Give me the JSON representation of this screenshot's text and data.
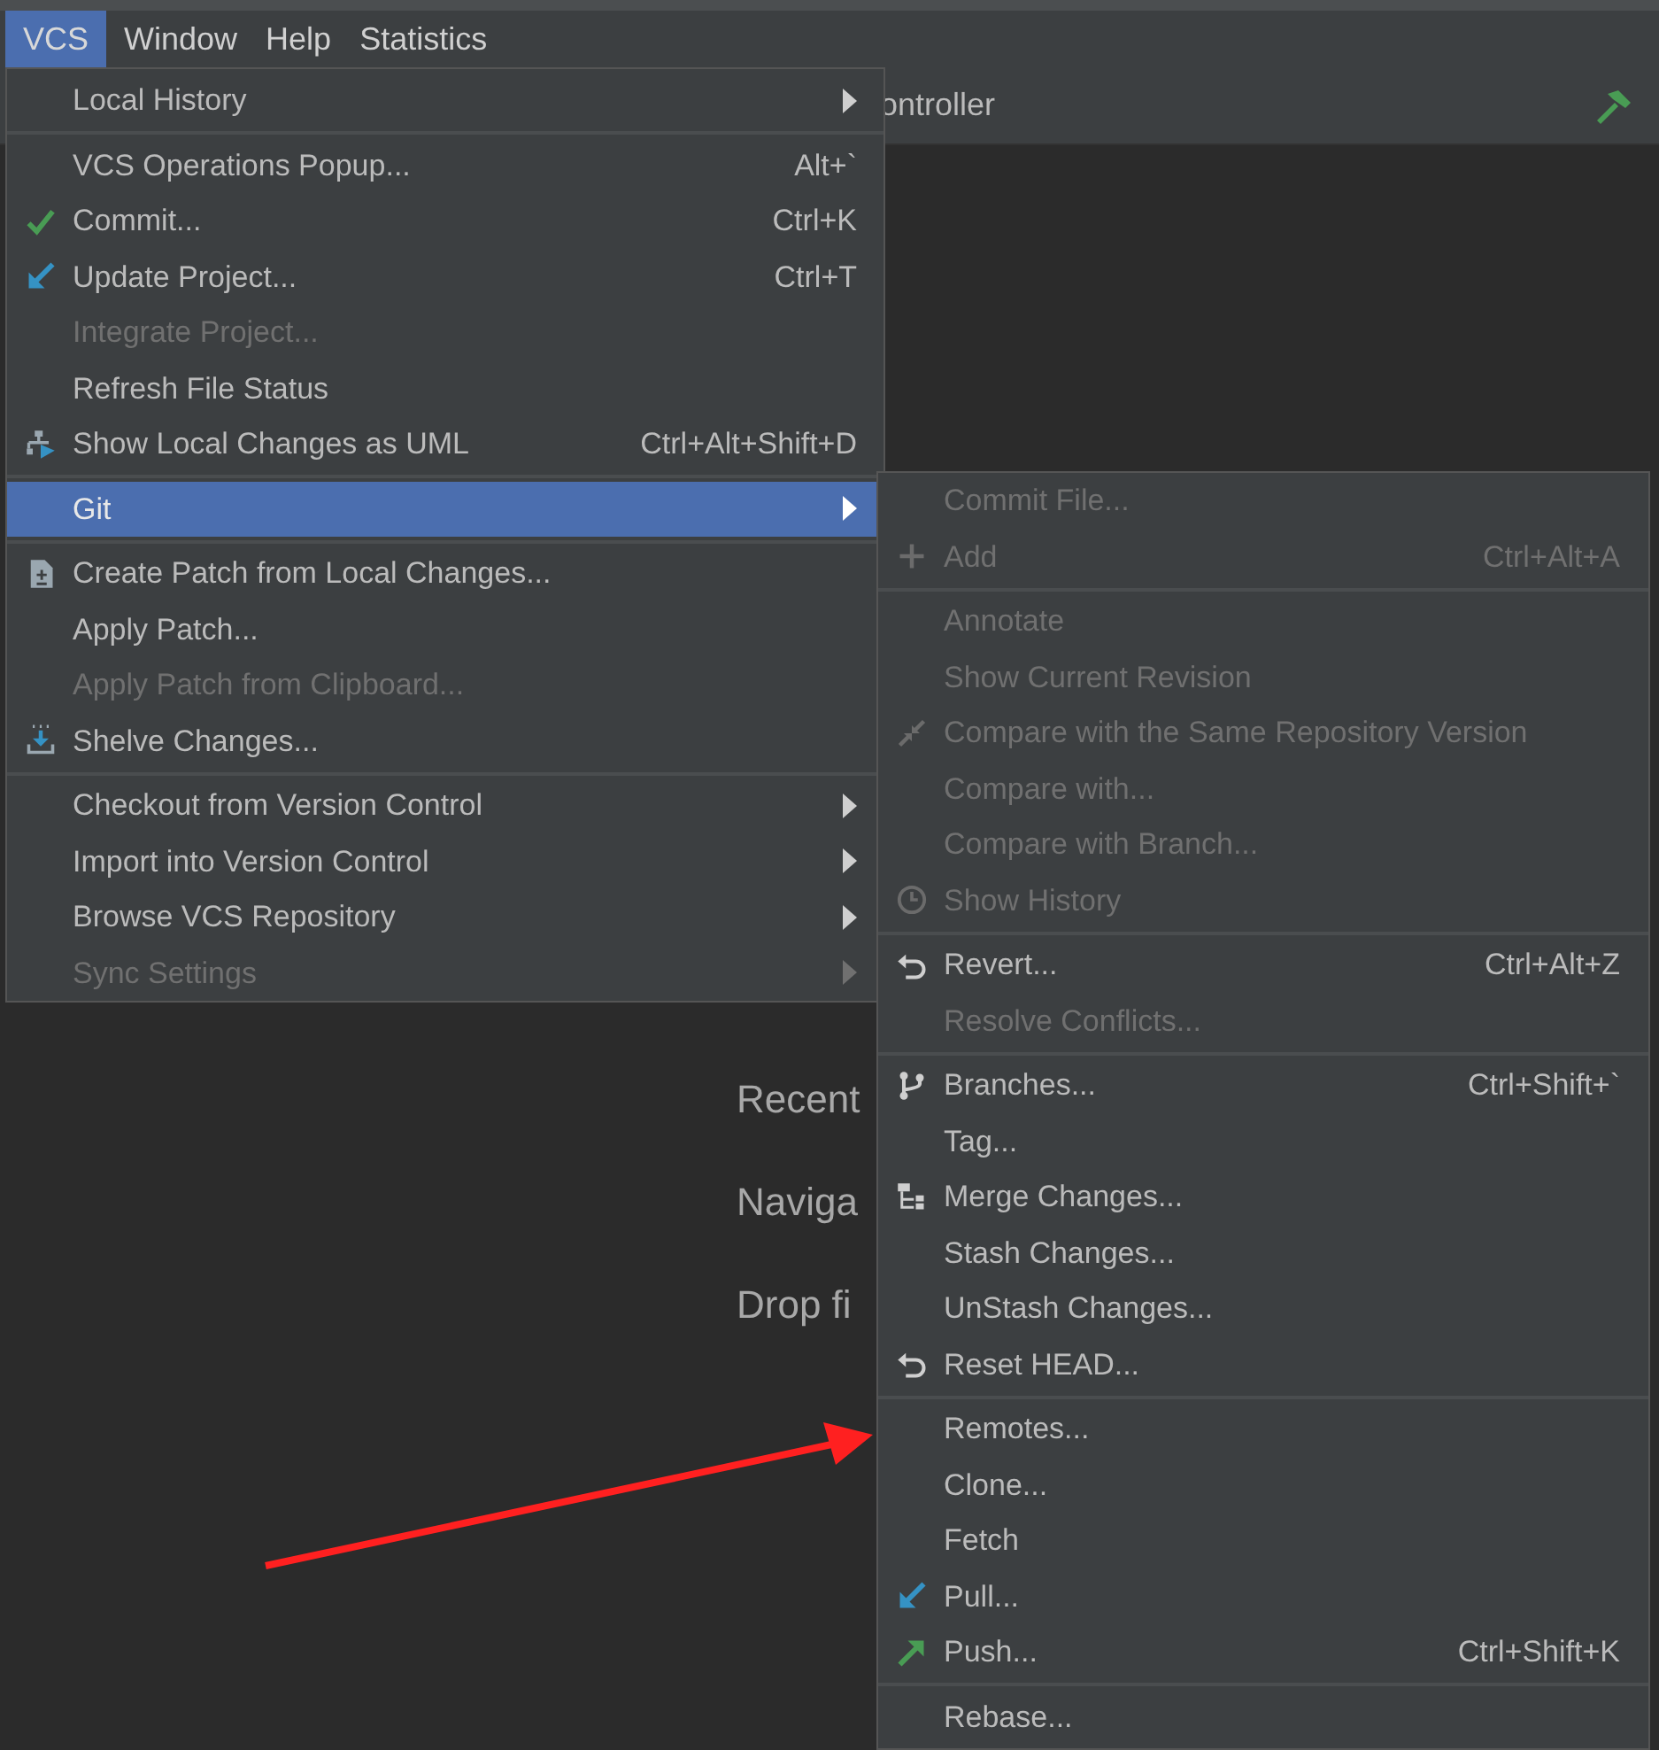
{
  "menu_bar": [
    {
      "label": "VCS",
      "selected": true
    },
    {
      "label": "Window",
      "selected": false
    },
    {
      "label": "Help",
      "selected": false
    },
    {
      "label": "Statistics",
      "selected": false
    }
  ],
  "toolbar": {
    "title": "ontroller"
  },
  "editor_hints": [
    "Recent",
    "Naviga",
    "Drop fi"
  ],
  "vcs_menu": [
    [
      {
        "label": "Local History",
        "has_submenu": true,
        "disabled": false,
        "selected": false
      }
    ],
    [
      {
        "label": "VCS Operations Popup...",
        "shortcut": "Alt+`",
        "has_submenu": false,
        "disabled": false,
        "selected": false
      },
      {
        "label": "Commit...",
        "shortcut": "Ctrl+K",
        "has_submenu": false,
        "disabled": false,
        "selected": false
      },
      {
        "label": "Update Project...",
        "shortcut": "Ctrl+T",
        "has_submenu": false,
        "disabled": false,
        "selected": false
      },
      {
        "label": "Integrate Project...",
        "has_submenu": false,
        "disabled": true,
        "selected": false
      },
      {
        "label": "Refresh File Status",
        "has_submenu": false,
        "disabled": false,
        "selected": false
      },
      {
        "label": "Show Local Changes as UML",
        "shortcut": "Ctrl+Alt+Shift+D",
        "has_submenu": false,
        "disabled": false,
        "selected": false
      }
    ],
    [
      {
        "label": "Git",
        "has_submenu": true,
        "disabled": false,
        "selected": true
      }
    ],
    [
      {
        "label": "Create Patch from Local Changes...",
        "has_submenu": false,
        "disabled": false,
        "selected": false
      },
      {
        "label": "Apply Patch...",
        "has_submenu": false,
        "disabled": false,
        "selected": false
      },
      {
        "label": "Apply Patch from Clipboard...",
        "has_submenu": false,
        "disabled": true,
        "selected": false
      },
      {
        "label": "Shelve Changes...",
        "has_submenu": false,
        "disabled": false,
        "selected": false
      }
    ],
    [
      {
        "label": "Checkout from Version Control",
        "has_submenu": true,
        "disabled": false,
        "selected": false
      },
      {
        "label": "Import into Version Control",
        "has_submenu": true,
        "disabled": false,
        "selected": false
      },
      {
        "label": "Browse VCS Repository",
        "has_submenu": true,
        "disabled": false,
        "selected": false
      },
      {
        "label": "Sync Settings",
        "has_submenu": true,
        "disabled": true,
        "selected": false
      }
    ]
  ],
  "git_menu": [
    [
      {
        "label": "Commit File...",
        "disabled": true
      },
      {
        "label": "Add",
        "shortcut": "Ctrl+Alt+A",
        "disabled": true
      }
    ],
    [
      {
        "label": "Annotate",
        "disabled": true
      },
      {
        "label": "Show Current Revision",
        "disabled": true
      },
      {
        "label": "Compare with the Same Repository Version",
        "disabled": true
      },
      {
        "label": "Compare with...",
        "disabled": true
      },
      {
        "label": "Compare with Branch...",
        "disabled": true
      },
      {
        "label": "Show History",
        "disabled": true
      }
    ],
    [
      {
        "label": "Revert...",
        "shortcut": "Ctrl+Alt+Z",
        "disabled": false
      },
      {
        "label": "Resolve Conflicts...",
        "disabled": true
      }
    ],
    [
      {
        "label": "Branches...",
        "shortcut": "Ctrl+Shift+`",
        "disabled": false
      },
      {
        "label": "Tag...",
        "disabled": false
      },
      {
        "label": "Merge Changes...",
        "disabled": false
      },
      {
        "label": "Stash Changes...",
        "disabled": false
      },
      {
        "label": "UnStash Changes...",
        "disabled": false
      },
      {
        "label": "Reset HEAD...",
        "disabled": false
      }
    ],
    [
      {
        "label": "Remotes...",
        "disabled": false
      },
      {
        "label": "Clone...",
        "disabled": false
      },
      {
        "label": "Fetch",
        "disabled": false
      },
      {
        "label": "Pull...",
        "disabled": false
      },
      {
        "label": "Push...",
        "shortcut": "Ctrl+Shift+K",
        "disabled": false
      }
    ],
    [
      {
        "label": "Rebase...",
        "disabled": false
      }
    ]
  ]
}
